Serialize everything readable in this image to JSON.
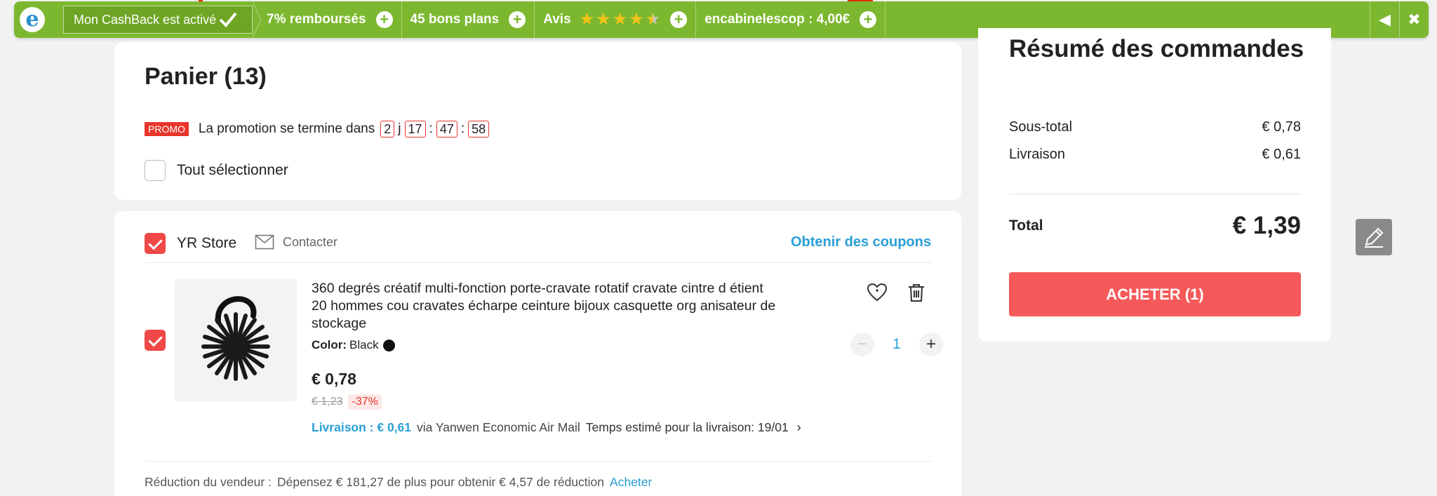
{
  "cashback_bar": {
    "logo": "e",
    "active_label": "Mon CashBack est activé",
    "refund_label": "7% remboursés",
    "deals_label": "45 bons plans",
    "reviews_label": "Avis",
    "rating": 4.5,
    "promo_code": "encabinelescop : 4,00€",
    "icons": [
      "check-icon",
      "plus-circle-icon",
      "star-icon",
      "collapse-left-icon",
      "close-icon"
    ],
    "color": "#7cb82f"
  },
  "cart": {
    "title": "Panier (13)",
    "promo_badge": "PROMO",
    "promo_text": "La promotion se termine dans",
    "timer": {
      "days": "2",
      "days_unit": "j",
      "hours": "17",
      "sep1": ":",
      "minutes": "47",
      "sep2": ":",
      "seconds": "58"
    },
    "select_all": "Tout sélectionner"
  },
  "store": {
    "name": "YR Store",
    "contact": "Contacter",
    "coupons": "Obtenir des coupons",
    "item": {
      "title": "360 degrés créatif multi-fonction porte-cravate rotatif cravate cintre d étient 20 hommes cou cravates écharpe ceinture bijoux casquette org anisateur de stockage",
      "color_label": "Color:",
      "color_value": "Black",
      "price": "€ 0,78",
      "old_price": "€ 1,23",
      "discount": "-37%",
      "shipping_fee": "Livraison : € 0,61",
      "shipping_via": "via Yanwen Economic Air Mail",
      "delivery_estimate": "Temps estimé pour la livraison: 19/01",
      "quantity": "1"
    },
    "seller_reduction": {
      "label": "Réduction du vendeur :",
      "text": "Dépensez € 181,27 de plus pour obtenir € 4,57 de réduction",
      "link": "Acheter"
    }
  },
  "summary": {
    "title": "Résumé des commandes",
    "subtotal_label": "Sous-total",
    "subtotal_value": "€ 0,78",
    "shipping_label": "Livraison",
    "shipping_value": "€ 0,61",
    "total_label": "Total",
    "total_value": "€ 1,39",
    "buy_button": "ACHETER (1)",
    "buy_color": "#f6595a"
  },
  "accent_colors": {
    "link": "#2a9fd6",
    "promo_red": "#e8352c",
    "check_red": "#f04747"
  }
}
